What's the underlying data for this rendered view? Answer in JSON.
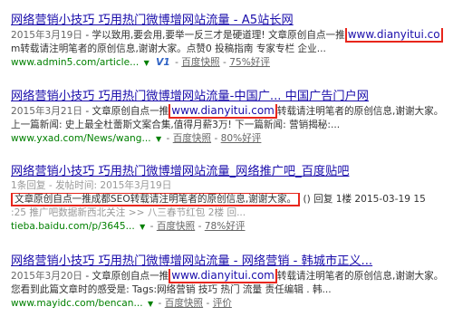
{
  "results": [
    {
      "title": "网络营销小技巧 巧用热门微博增网站流量 - A5站长网",
      "date": "2015年3月19日",
      "desc_before": " - 学以致用,要会用,要举一反三才是硬道理! 文章原创自点一推",
      "highlight": "www.dianyitui.co",
      "desc_line2": "m转载请注明笔者的原创信息,谢谢大家。点赞0 投稿指南 专家专栏 企业...",
      "url": "www.admin5.com/article...",
      "v1": "V1",
      "sep": " - ",
      "cache": "百度快照",
      "rating": "75%好评"
    },
    {
      "title": "网络营销小技巧 巧用热门微博增网站流量-中国广... 中国广告门户网",
      "date": "2015年3月21日",
      "desc_before": " - 文章原创自点一推",
      "highlight": "www.dianyitui.com",
      "desc_after": "转载请注明笔者的原创信息,谢谢大家。",
      "desc_line2": "上一篇新闻: 史上最全杜蕾斯文案合集,值得月薪3万! 下一篇新闻: 营销揭秘:...",
      "url": "www.yxad.com/News/wang...",
      "sep": " - ",
      "cache": "百度快照",
      "rating": "80%好评"
    },
    {
      "title": "网络营销小技巧 巧用热门微博增网站流量_网络推广吧_百度贴吧",
      "meta_line": "1条回复 - 发帖时间: 2015年3月19日",
      "highlight_sentence": "文章原创自点一推成都SEO转载请注明笔者的原创信息,谢谢大家。",
      "desc_after": " () 回复 1楼 2015-03-19 15",
      "desc_line3": ":25 推广吧数据新西北关注  >> 八三春节红包 2楼 回...",
      "url": "tieba.baidu.com/p/3645...",
      "sep": " - ",
      "cache": "百度快照",
      "rating": "78%好评"
    },
    {
      "title": "网络营销小技巧 巧用热门微博增网站流量 - 网络营销 - 韩城市正义...",
      "date": "2015年3月20日",
      "desc_before": " - 文章原创自点一推",
      "highlight": "www.dianyitui.com",
      "desc_after": "转载请注明笔者的原创信息,谢谢大家。",
      "desc_line2": "您看到此篇文章时的感受是: Tags:网络营销 技巧 热门 流量 责任编辑 . 韩...",
      "url": "www.mayidc.com/bencan...",
      "sep": " - ",
      "cache": "百度快照",
      "rating": "评价"
    }
  ]
}
